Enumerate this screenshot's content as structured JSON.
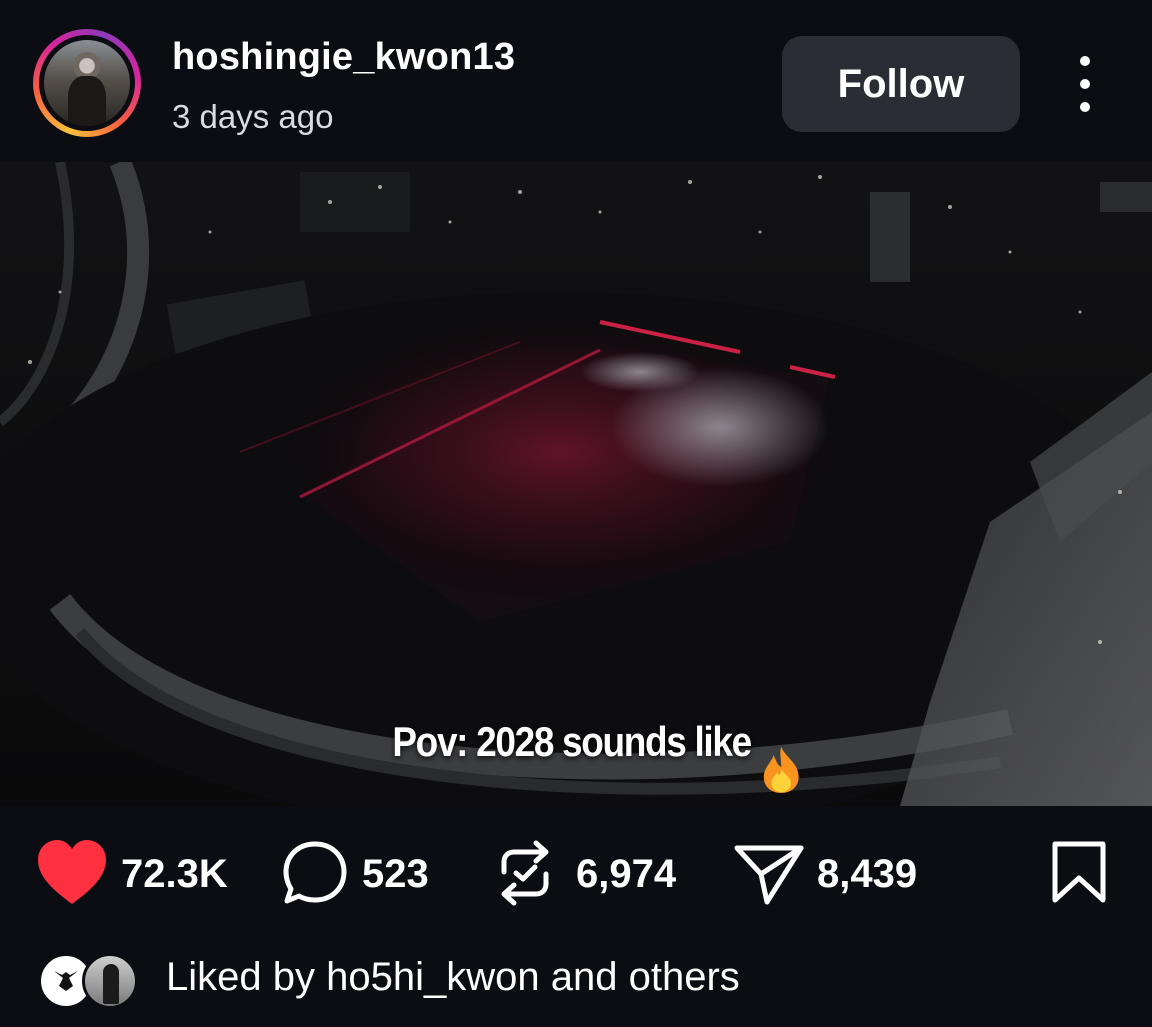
{
  "header": {
    "username": "hoshingie_kwon13",
    "timestamp": "3 days ago",
    "follow_label": "Follow",
    "more_icon": "more-vertical-icon",
    "avatar_ring_colors": [
      "#f9c23c",
      "#f56040",
      "#d6249f",
      "#8a3ab9"
    ]
  },
  "video": {
    "caption": "Pov: 2028 sounds like",
    "caption_emoji": "🔥",
    "tag_icon": "user-icon",
    "sound_icon": "volume-icon",
    "stage_light_color": "#c0163a"
  },
  "actions": {
    "likes": "72.3K",
    "comments": "523",
    "reposts": "6,974",
    "shares": "8,439",
    "like_icon": "heart-icon",
    "comment_icon": "comment-icon",
    "repost_icon": "repost-icon",
    "share_icon": "send-icon",
    "save_icon": "bookmark-icon",
    "like_color": "#ff3040"
  },
  "liked_by": {
    "prefix": "Liked by",
    "user": "ho5hi_kwon",
    "suffix": "and others"
  }
}
